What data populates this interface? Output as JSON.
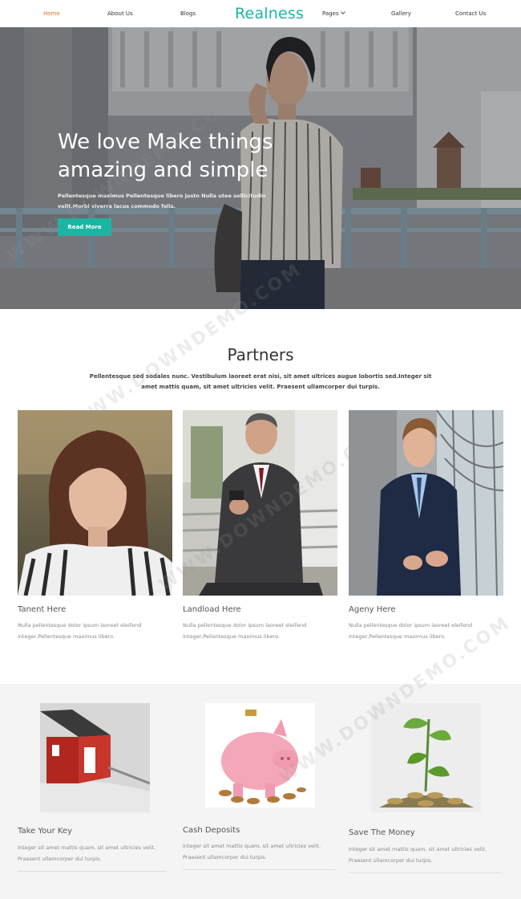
{
  "nav": {
    "items": [
      {
        "label": "Home"
      },
      {
        "label": "About Us"
      },
      {
        "label": "Blogs"
      },
      {
        "label": "Pages"
      },
      {
        "label": "Gallery"
      },
      {
        "label": "Contact Us"
      }
    ],
    "logo": "Realness"
  },
  "hero": {
    "title_line1": "We love Make things",
    "title_line2": "amazing and simple",
    "text": "Pellentesque maximus Pellentesque libero justo Nulla utee sollicitudin velit.Morbi viverra lacus commodo felis.",
    "button": "Read More"
  },
  "partners": {
    "title": "Partners",
    "desc": "Pellentesque sed sodales nunc. Vestibulum laoreet erat nisi, sit amet ultrices augue lobortis sed.Integer sit amet mattis quam, sit amet ultricies velit. Praesent ullamcorper dui turpis.",
    "cards": [
      {
        "title": "Tanent Here",
        "text": "Nulla pellentesque dolor ipsum laoreet eleifend integer,Pellentesque maximus libero."
      },
      {
        "title": "Landload Here",
        "text": "Nulla pellentesque dolor ipsum laoreet eleifend integer,Pellentesque maximus libero."
      },
      {
        "title": "Ageny Here",
        "text": "Nulla pellentesque dolor ipsum laoreet eleifend integer,Pellentesque maximus libero."
      }
    ]
  },
  "services": [
    {
      "title": "Take Your Key",
      "text": "Integer sit amet mattis quam, sit amet ultricies velit. Praesent ullamcorper dui turpis."
    },
    {
      "title": "Cash Deposits",
      "text": "Integer sit amet mattis quam, sit amet ultricies velit. Praesent ullamcorper dui turpis."
    },
    {
      "title": "Save The Money",
      "text": "Integer sit amet mattis quam, sit amet ultricies velit. Praesent ullamcorper dui turpis."
    }
  ],
  "watermark": "WWW.DOWNDEMO.COM",
  "colors": {
    "accent": "#1bb5a3",
    "active_nav": "#e8711f"
  }
}
